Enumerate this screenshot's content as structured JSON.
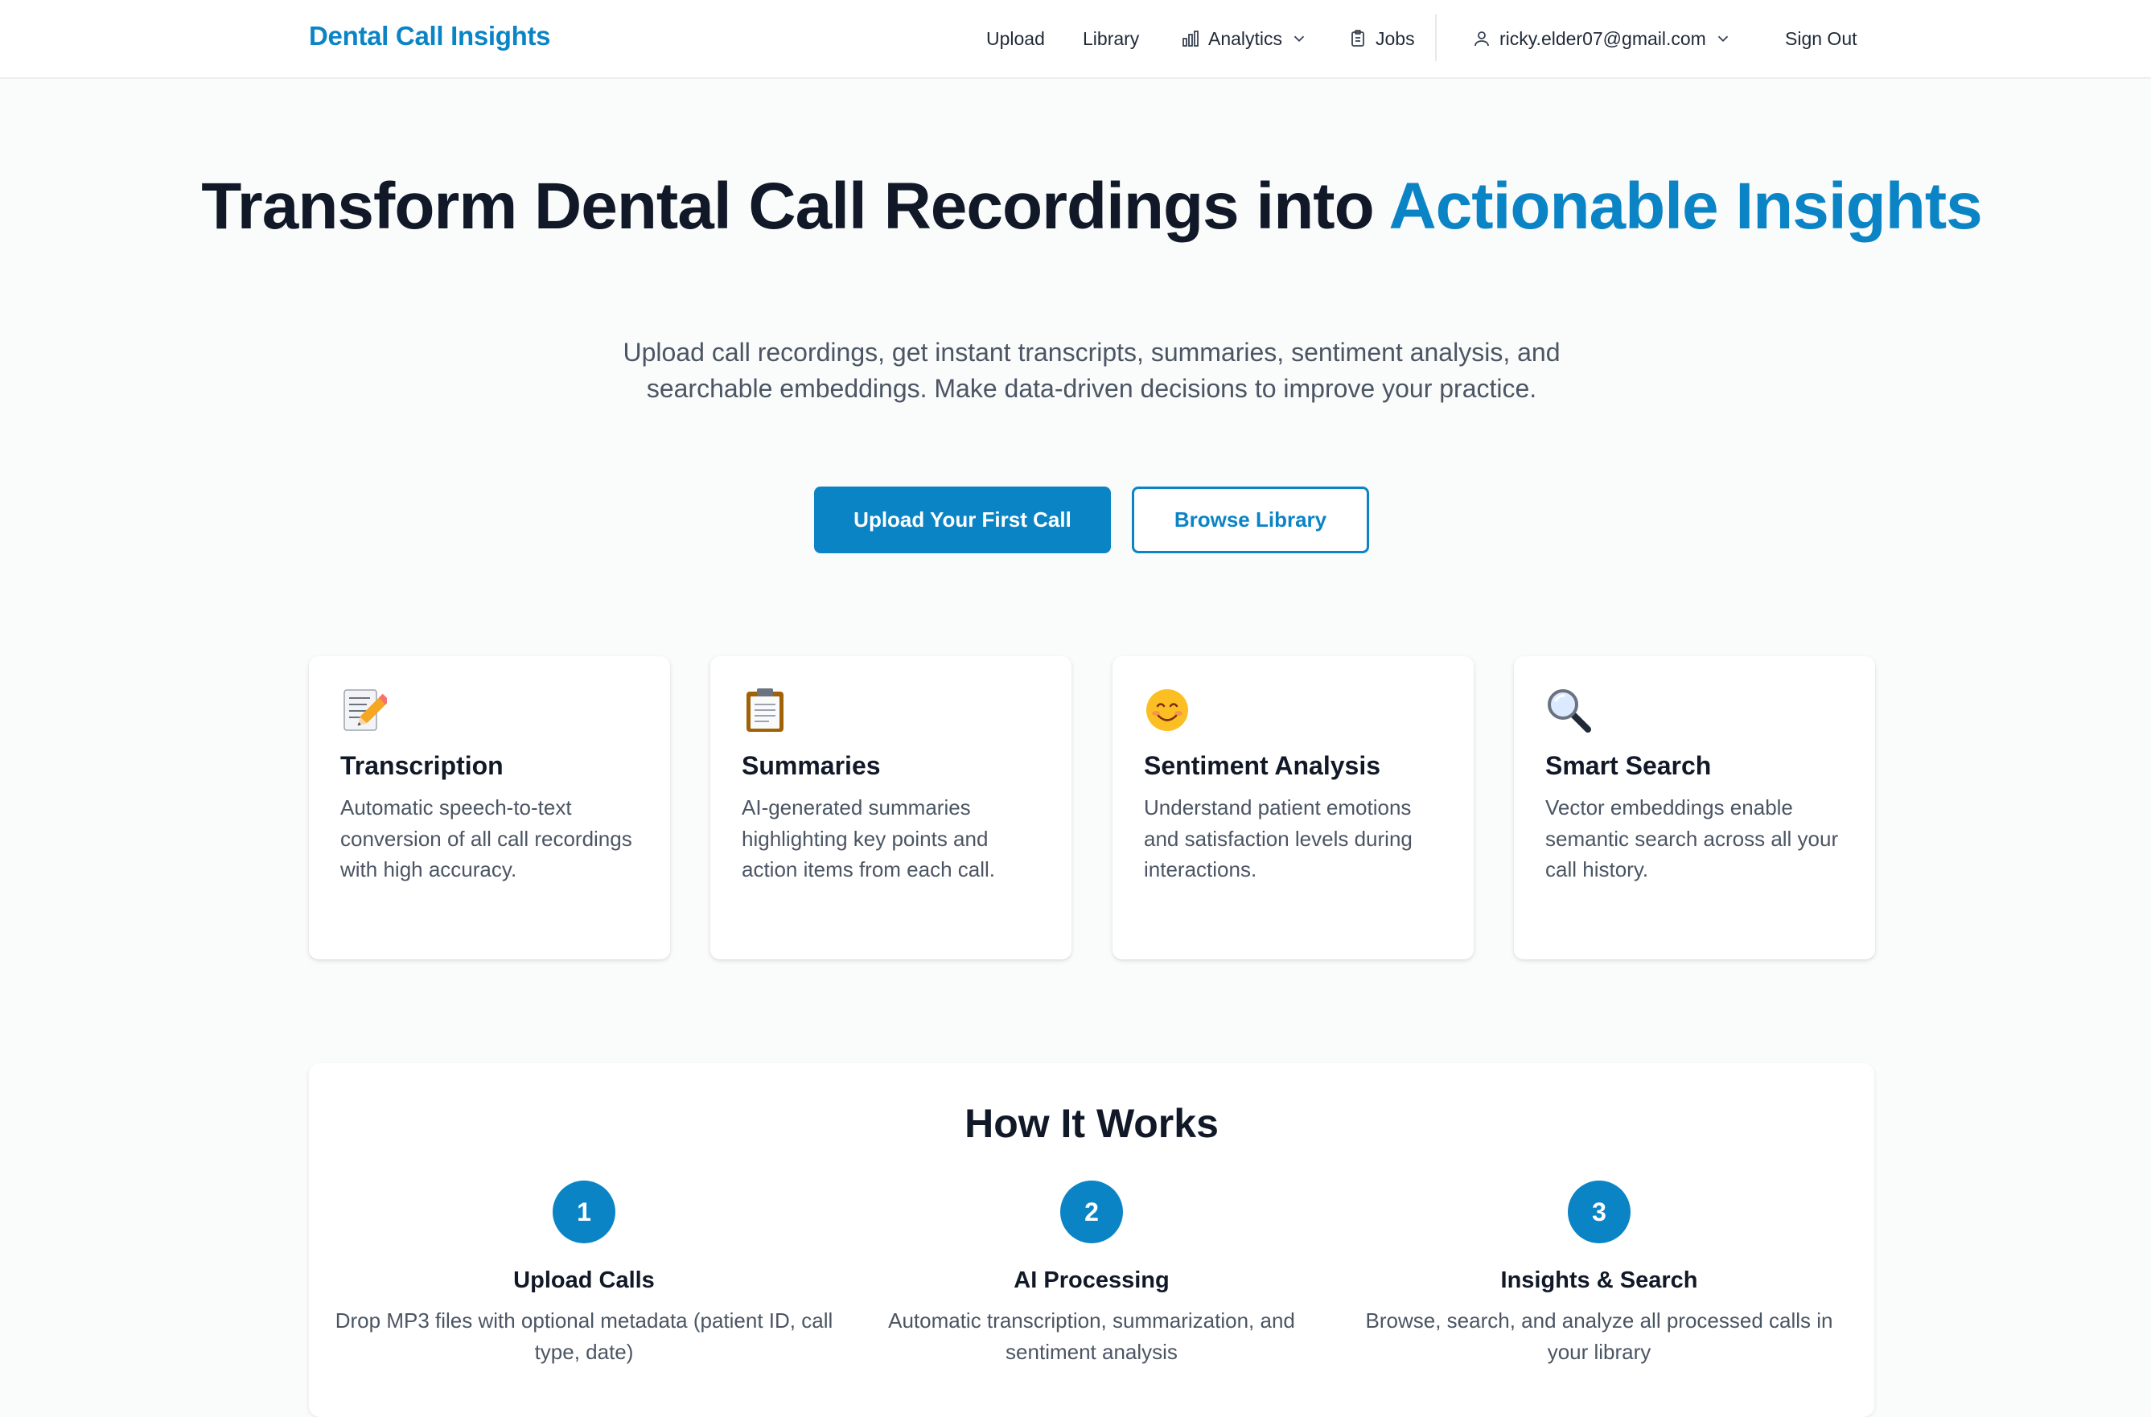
{
  "nav": {
    "brand": "Dental Call Insights",
    "upload": "Upload",
    "library": "Library",
    "analytics": "Analytics",
    "jobs": "Jobs",
    "user_email": "ricky.elder07@gmail.com",
    "sign_out": "Sign Out"
  },
  "hero": {
    "title_main": "Transform Dental Call Recordings into",
    "title_accent": "Actionable Insights",
    "subtitle": "Upload call recordings, get instant transcripts, summaries, sentiment analysis, and searchable embeddings. Make data-driven decisions to improve your practice.",
    "primary_button": "Upload Your First Call",
    "secondary_button": "Browse Library"
  },
  "features": [
    {
      "icon": "memo-icon",
      "title": "Transcription",
      "desc": "Automatic speech-to-text conversion of all call recordings with high accuracy."
    },
    {
      "icon": "clipboard-icon",
      "title": "Summaries",
      "desc": "AI-generated summaries highlighting key points and action items from each call."
    },
    {
      "icon": "smiling-face-icon",
      "title": "Sentiment Analysis",
      "desc": "Understand patient emotions and satisfaction levels during interactions."
    },
    {
      "icon": "magnifying-glass-icon",
      "title": "Smart Search",
      "desc": "Vector embeddings enable semantic search across all your call history."
    }
  ],
  "how": {
    "title": "How It Works",
    "steps": [
      {
        "num": "1",
        "title": "Upload Calls",
        "desc": "Drop MP3 files with optional metadata (patient ID, call type, date)"
      },
      {
        "num": "2",
        "title": "AI Processing",
        "desc": "Automatic transcription, summarization, and sentiment analysis"
      },
      {
        "num": "3",
        "title": "Insights & Search",
        "desc": "Browse, search, and analyze all processed calls in your library"
      }
    ]
  },
  "colors": {
    "accent": "#0b84c6",
    "text": "#111827",
    "muted": "#4b5563"
  }
}
